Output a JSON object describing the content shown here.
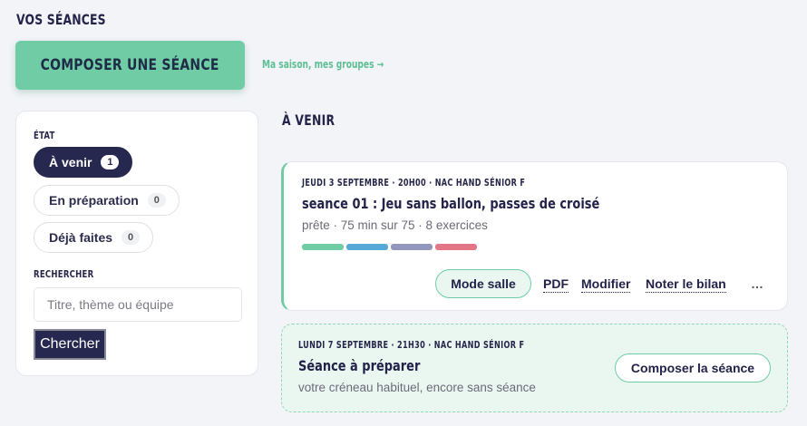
{
  "page": {
    "title": "VOS SÉANCES"
  },
  "header": {
    "compose_label": "COMPOSER UNE SÉANCE",
    "season_link": "Ma saison, mes groupes →"
  },
  "sidebar": {
    "state_label": "ÉTAT",
    "filters": [
      {
        "label": "À venir",
        "count": "1",
        "active": true
      },
      {
        "label": "En préparation",
        "count": "0",
        "active": false
      },
      {
        "label": "Déjà faites",
        "count": "0",
        "active": false
      }
    ],
    "search_label": "RECHERCHER",
    "search_placeholder": "Titre, thème ou équipe",
    "search_value": "",
    "search_button": "Chercher"
  },
  "main": {
    "section_title": "À VENIR",
    "sessions": [
      {
        "meta": "JEUDI 3 SEPTEMBRE · 20H00 · NAC HAND SÉNIOR F",
        "title": "seance 01 : Jeu sans ballon, passes de croisé",
        "subtitle": "prête · 75 min sur 75 · 8 exercices",
        "bar_colors": [
          "#6fcca4",
          "#56a9d6",
          "#9497bd",
          "#e27687"
        ],
        "actions": {
          "mode": "Mode salle",
          "pdf": "PDF",
          "edit": "Modifier",
          "review": "Noter le bilan",
          "more": "…"
        }
      }
    ],
    "pending": {
      "meta": "LUNDI 7 SEPTEMBRE · 21H30 · NAC HAND SÉNIOR F",
      "title": "Séance à préparer",
      "subtitle": "votre créneau habituel, encore sans séance",
      "button": "Composer la séance"
    }
  },
  "colors": {
    "accent": "#6fcca4",
    "navy": "#27284f",
    "background": "#f3f4f8"
  }
}
